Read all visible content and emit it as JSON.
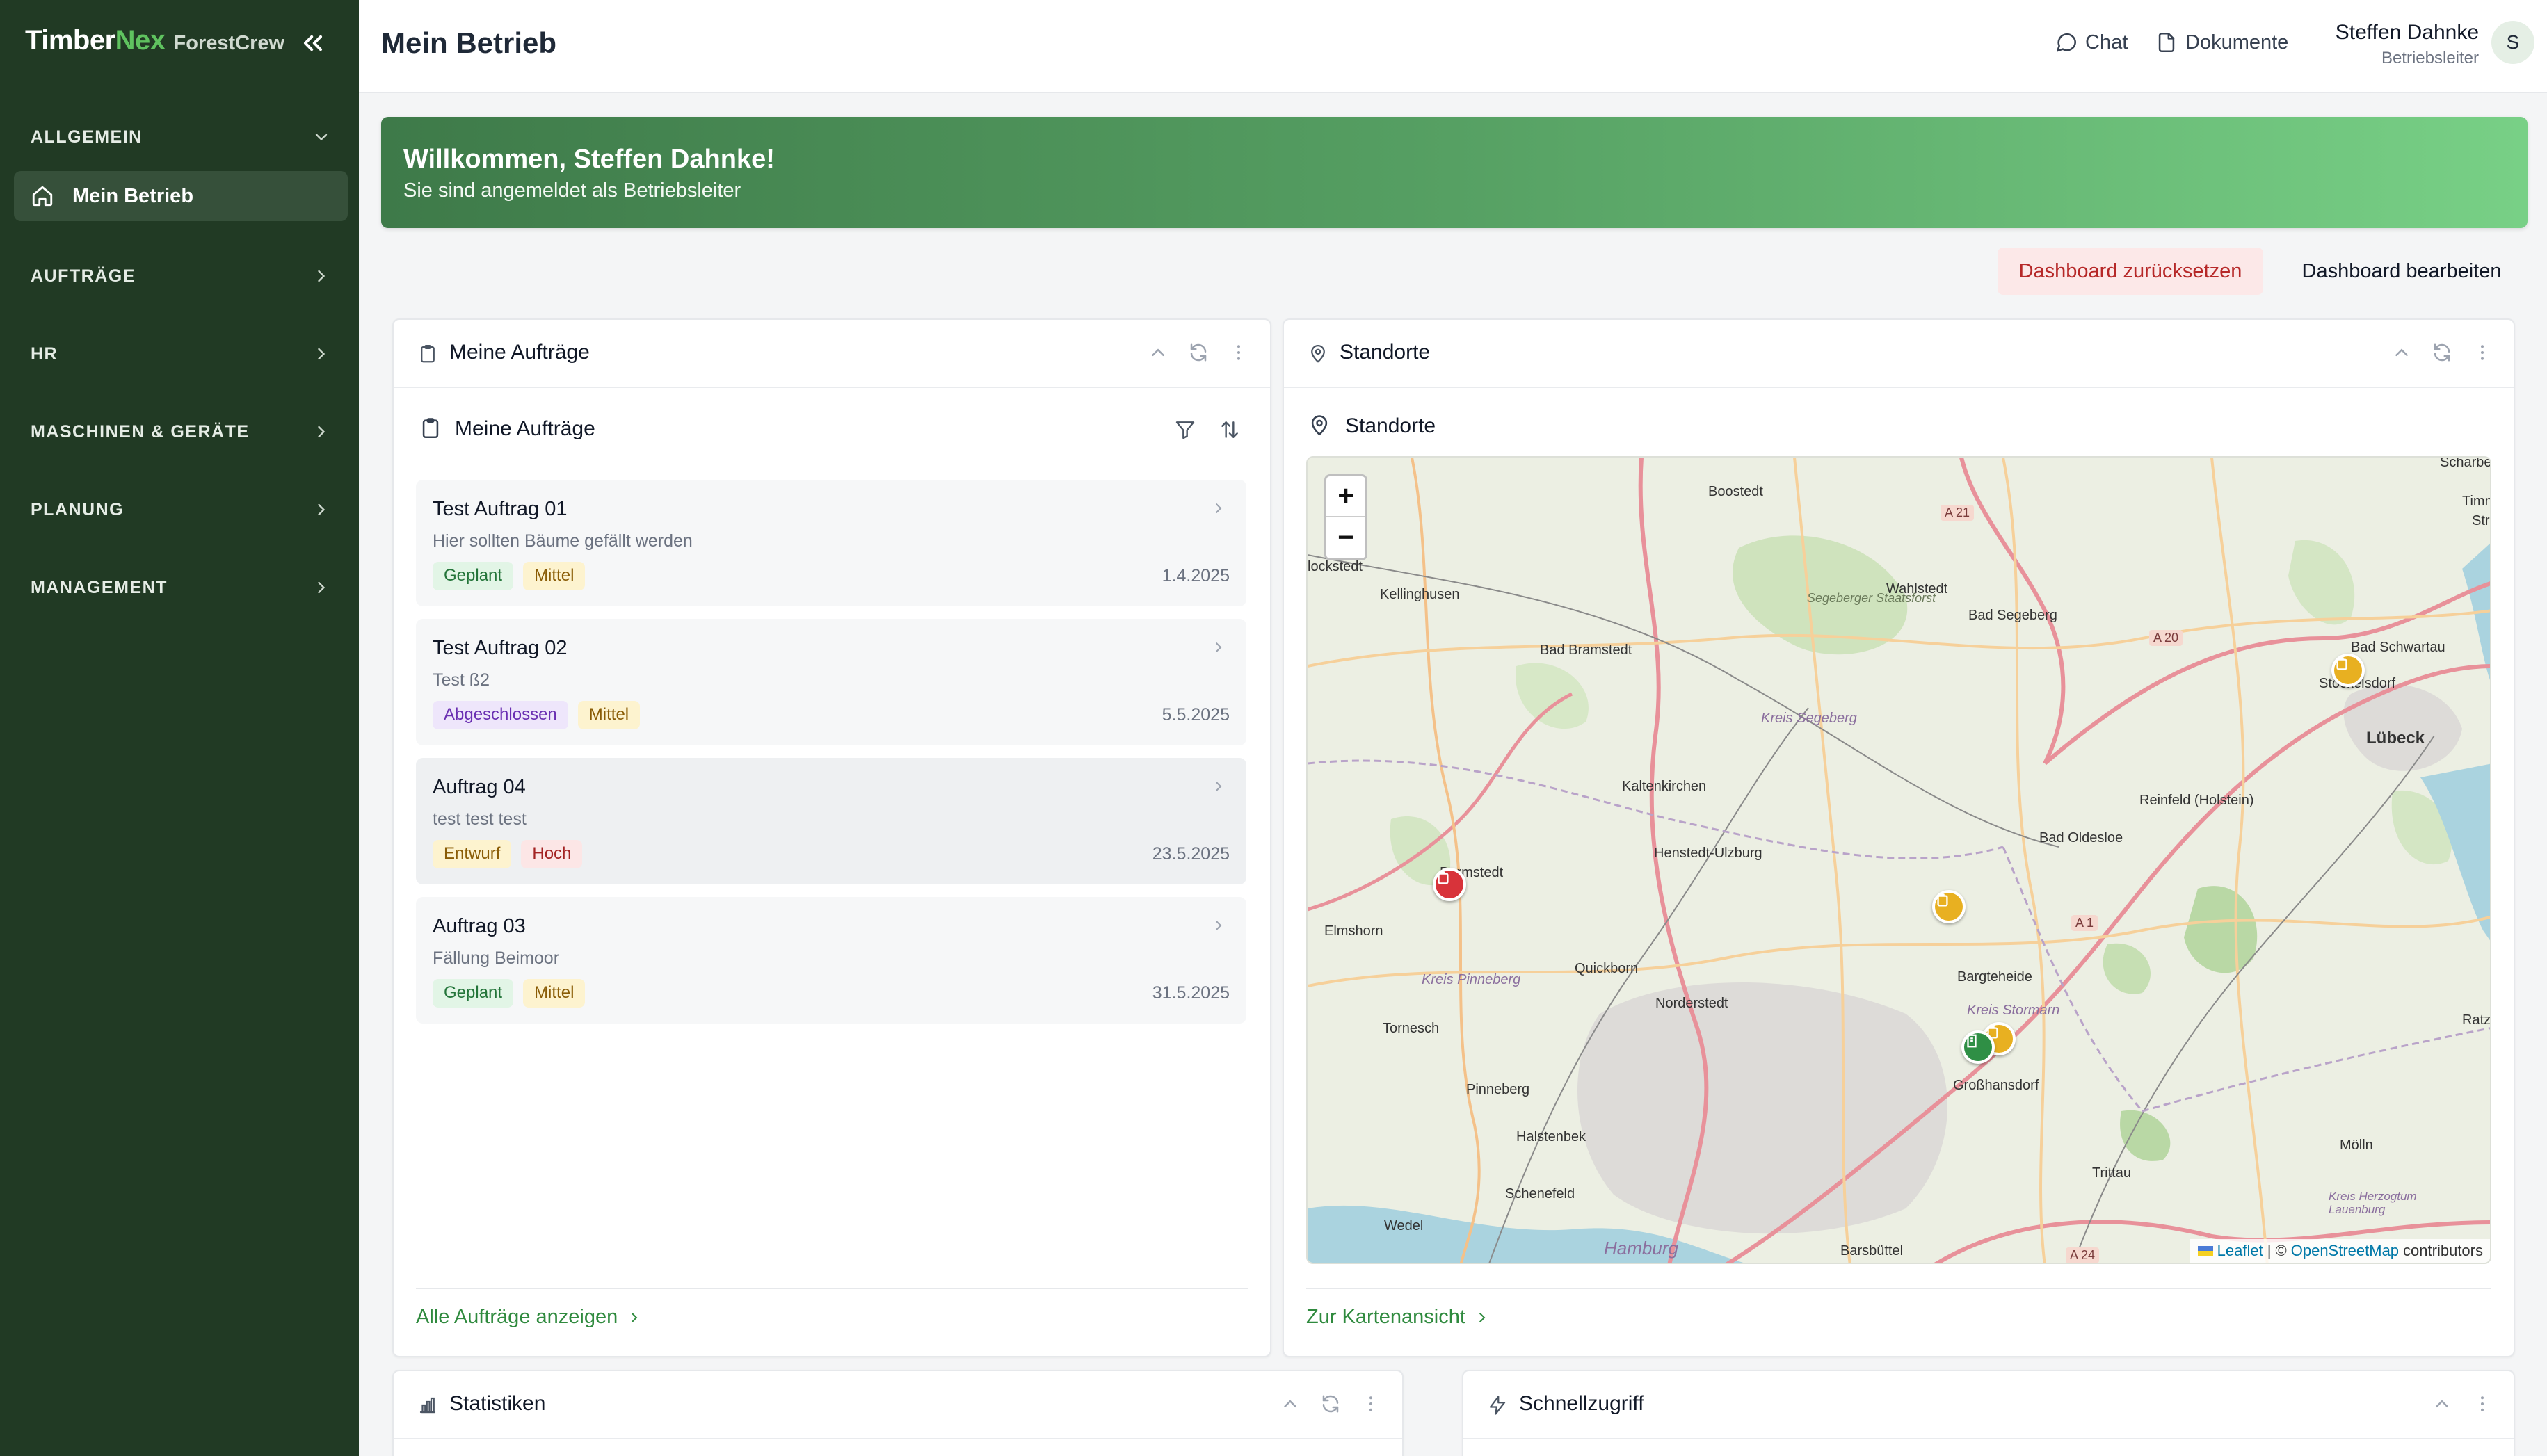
{
  "brand": {
    "name_part1": "Timber",
    "name_part2": "Nex",
    "product": "ForestCrew"
  },
  "sidebar": {
    "sections": [
      {
        "label": "ALLGEMEIN",
        "expanded": true,
        "items": [
          {
            "label": "Mein Betrieb",
            "icon": "home-icon",
            "active": true
          }
        ]
      },
      {
        "label": "AUFTRÄGE"
      },
      {
        "label": "HR"
      },
      {
        "label": "MASCHINEN & GERÄTE"
      },
      {
        "label": "PLANUNG"
      },
      {
        "label": "MANAGEMENT"
      }
    ]
  },
  "header": {
    "title": "Mein Betrieb",
    "chat_label": "Chat",
    "docs_label": "Dokumente",
    "user_name": "Steffen Dahnke",
    "user_role": "Betriebsleiter",
    "avatar_initial": "S"
  },
  "banner": {
    "heading": "Willkommen, Steffen Dahnke!",
    "subtext": "Sie sind angemeldet als Betriebsleiter"
  },
  "actions": {
    "reset_label": "Dashboard zurücksetzen",
    "edit_label": "Dashboard bearbeiten"
  },
  "orders_widget": {
    "title": "Meine Aufträge",
    "subtitle": "Meine Aufträge",
    "orders": [
      {
        "name": "Test Auftrag 01",
        "desc": "Hier sollten Bäume gefällt werden",
        "status": "Geplant",
        "priority": "Mittel",
        "date": "1.4.2025"
      },
      {
        "name": "Test Auftrag 02",
        "desc": "Test ß2",
        "status": "Abgeschlossen",
        "priority": "Mittel",
        "date": "5.5.2025"
      },
      {
        "name": "Auftrag 04",
        "desc": "test test test",
        "status": "Entwurf",
        "priority": "Hoch",
        "date": "23.5.2025"
      },
      {
        "name": "Auftrag 03",
        "desc": "Fällung Beimoor",
        "status": "Geplant",
        "priority": "Mittel",
        "date": "31.5.2025"
      }
    ],
    "footer_link": "Alle Aufträge anzeigen"
  },
  "locations_widget": {
    "title": "Standorte",
    "subtitle": "Standorte",
    "footer_link": "Zur Kartenansicht",
    "zoom_in": "+",
    "zoom_out": "−",
    "attribution": {
      "leaflet": "Leaflet",
      "sep": "| ©",
      "osm": "OpenStreetMap",
      "suffix": "contributors"
    },
    "places": [
      "Boostedt",
      "Kellinghusen",
      "lockstedt",
      "Wahlstedt",
      "Bad Segeberg",
      "Bad Bramstedt",
      "Kreis Segeberg",
      "Segeberger Staatsforst",
      "Bad Schwartau",
      "Stockelsdorf",
      "Lübeck",
      "Reinfeld (Holstein)",
      "Kaltenkirchen",
      "Henstedt-Ulzburg",
      "Bad Oldesloe",
      "Barmstedt",
      "Elmshorn",
      "Quickborn",
      "Bargteheide",
      "Kreis Stormarn",
      "Kreis Pinneberg",
      "Tornesch",
      "Norderstedt",
      "Großhansdorf",
      "Pinneberg",
      "Halstenbek",
      "Schenefeld",
      "Wedel",
      "Hamburg",
      "Barsbüttel",
      "Trittau",
      "Mölln",
      "Kreis Herzogtum Lauenburg",
      "Ratze",
      "Scharbe",
      "Timme",
      "Str"
    ],
    "roads": [
      "A 21",
      "A 20",
      "A 1",
      "A 24"
    ]
  },
  "stats_widget": {
    "title": "Statistiken"
  },
  "quick_widget": {
    "title": "Schnellzugriff"
  },
  "colors": {
    "sidebar": "#213a24",
    "accent": "#2f8a3e",
    "banner_start": "#3e7a49",
    "banner_end": "#78d086"
  }
}
